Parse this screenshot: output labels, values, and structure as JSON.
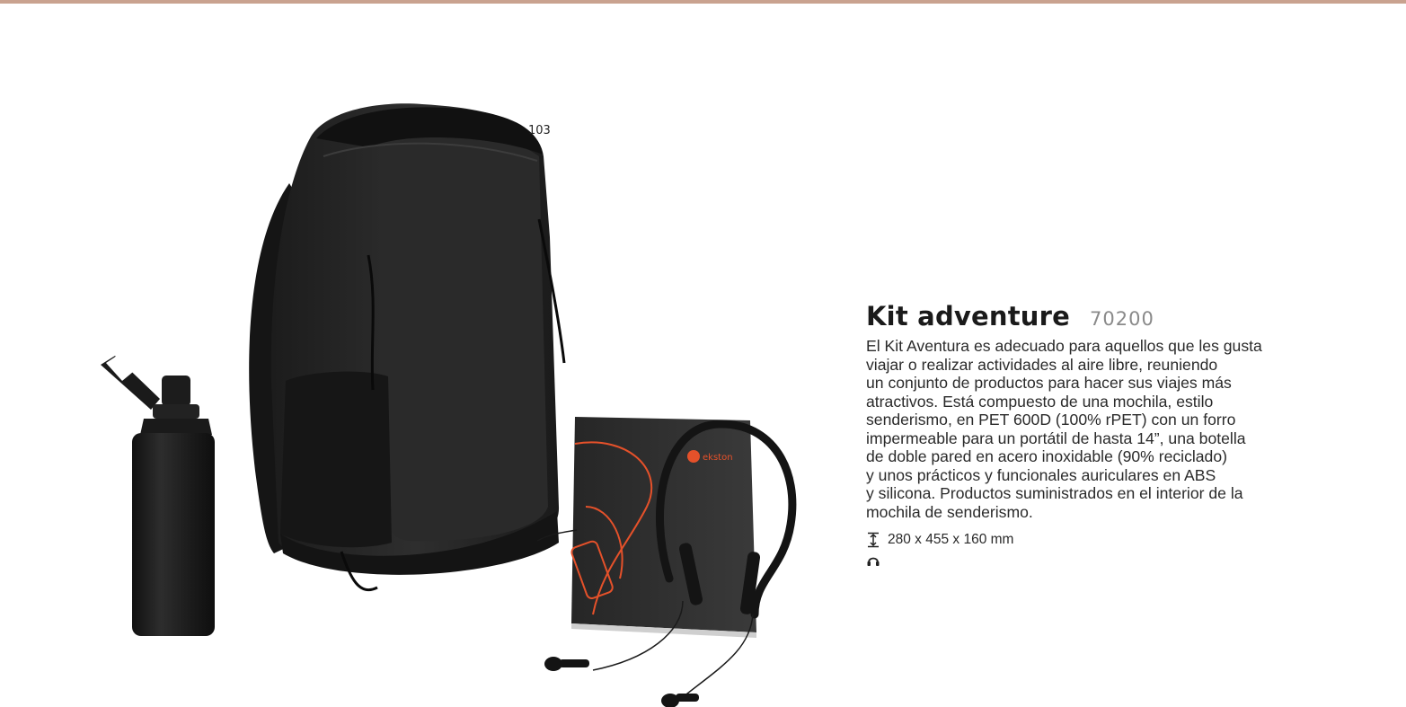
{
  "page": {
    "number": "103",
    "accent_color": "#c9a28f"
  },
  "product": {
    "title": "Kit adventure",
    "ref": "70200",
    "description_lines": [
      "El Kit Aventura es adecuado para aquellos que les gusta",
      "viajar o realizar actividades al aire libre, reuniendo",
      "un conjunto de productos para hacer sus viajes más",
      "atractivos. Está compuesto de una mochila, estilo",
      "senderismo, en PET 600D (100% rPET) con un forro",
      "impermeable para un portátil de hasta 14”, una botella",
      "de doble pared en acero inoxidable (90% reciclado)",
      "y unos prácticos y funcionales auriculares en ABS",
      "y silicona. Productos suministrados en el interior de la",
      "mochila de senderismo."
    ],
    "dimensions": "280 x 455 x 160 mm",
    "dimensions_icon": "height-arrow-icon",
    "feature_icon": "headphones-icon"
  },
  "photo": {
    "items": [
      "backpack",
      "water-bottle",
      "earphones-box",
      "neckband-earphones"
    ],
    "brand_on_box": "ekston"
  }
}
